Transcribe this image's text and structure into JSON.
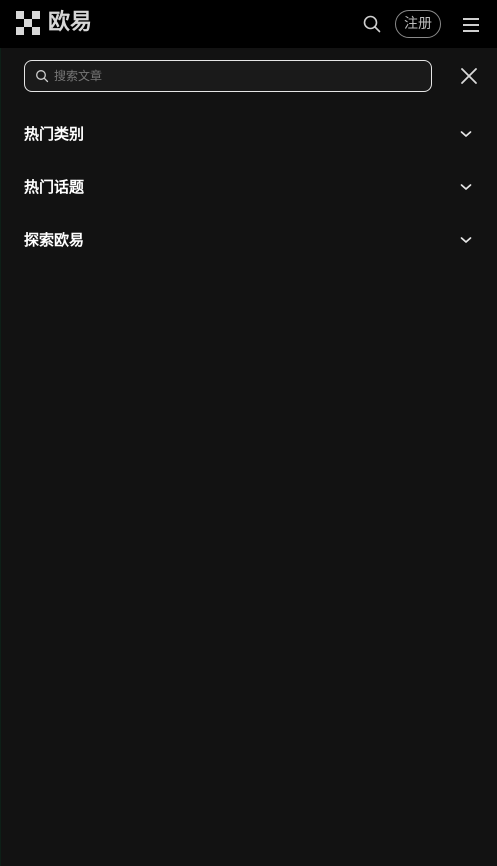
{
  "header": {
    "brand": "欧易",
    "signup_label": "注册"
  },
  "search": {
    "placeholder": "搜索文章"
  },
  "sections": [
    {
      "label": "热门类别"
    },
    {
      "label": "热门话题"
    },
    {
      "label": "探索欧易"
    }
  ],
  "colors": {
    "page_bg": "#000000",
    "panel_bg": "#121212",
    "text": "#ffffff",
    "muted": "#777777"
  }
}
